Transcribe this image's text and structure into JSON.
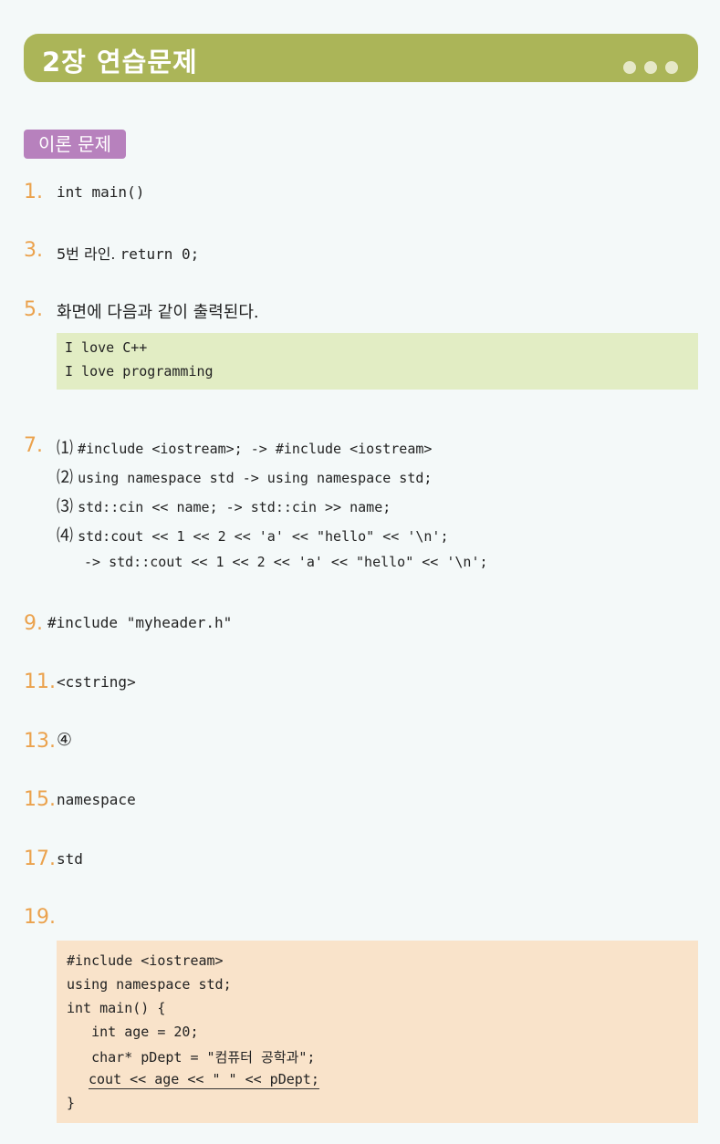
{
  "header": {
    "title": "2장 연습문제"
  },
  "section": {
    "label": "이론 문제"
  },
  "q1": {
    "num": "1.",
    "answer": "int main()"
  },
  "q3": {
    "num": "3.",
    "prefix": "5번 라인.",
    "code": "return 0;"
  },
  "q5": {
    "num": "5.",
    "text": "화면에 다음과 같이 출력된다.",
    "output": [
      "I love C++",
      "I love programming"
    ]
  },
  "q7": {
    "num": "7.",
    "items": [
      {
        "marker": "⑴",
        "text": "#include <iostream>; -> #include <iostream>"
      },
      {
        "marker": "⑵",
        "text": "using namespace std -> using namespace std;"
      },
      {
        "marker": "⑶",
        "text": "std::cin << name; -> std::cin >> name;"
      },
      {
        "marker": "⑷",
        "text": "std:cout << 1 << 2 << 'a' << \"hello\" << '\\n';"
      }
    ],
    "continuation": "-> std::cout << 1 << 2 << 'a' << \"hello\" << '\\n';"
  },
  "q9": {
    "num": "9.",
    "answer": "#include \"myheader.h\""
  },
  "q11": {
    "num": "11.",
    "answer": "<cstring>"
  },
  "q13": {
    "num": "13.",
    "answer": "④"
  },
  "q15": {
    "num": "15.",
    "answer": "namespace"
  },
  "q17": {
    "num": "17.",
    "answer": "std"
  },
  "q19": {
    "num": "19.",
    "code": [
      "#include <iostream>",
      "using namespace std;",
      "int main() {",
      "   int age = 20;",
      "   char* pDept = \"컴퓨터 공학과\";",
      "cout << age << \" \" << pDept;",
      "}"
    ]
  },
  "colors": {
    "header": "#abb558",
    "badge": "#b781bd",
    "number": "#eba24d",
    "green_box": "#e2edc4",
    "code_box": "#f9e3ca"
  }
}
